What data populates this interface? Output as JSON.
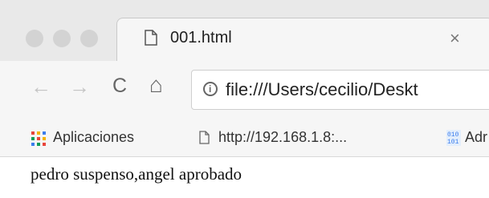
{
  "tab": {
    "title": "001.html",
    "close_glyph": "×"
  },
  "toolbar": {
    "back_glyph": "←",
    "forward_glyph": "→",
    "reload_glyph": "C",
    "home_glyph": "⌂",
    "url": "file:///Users/cecilio/Deskt"
  },
  "bookmarks": {
    "items": [
      {
        "label": "Aplicaciones",
        "icon": "apps-icon"
      },
      {
        "label": "http://192.168.1.8:...",
        "icon": "page-icon"
      },
      {
        "label": "Adr",
        "icon": "binary-icon"
      }
    ]
  },
  "page": {
    "text": "pedro suspenso,angel aprobado"
  },
  "colors": {
    "tabstrip": "#e9e9e9",
    "toolbar": "#f6f6f6",
    "traffic_light": "#d3d3d3"
  }
}
